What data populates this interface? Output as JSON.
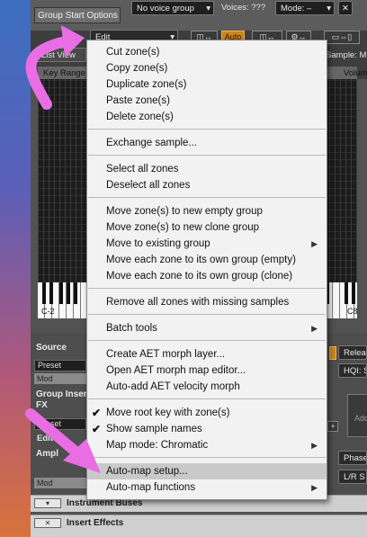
{
  "colors": {
    "accent_orange": "#c9861f",
    "menu_bg": "#f2f2f2",
    "highlight": "#c9c9c9",
    "pointer_arrow": "#e96ee3"
  },
  "header": {
    "group_start_options_tab": "Group Start Options",
    "voice_group": "No voice group",
    "voices_label": "Voices: ???",
    "mode_label": "Mode: –"
  },
  "toolbar": {
    "edit_dropdown": "Edit",
    "auto_button": "Auto",
    "list_view": "List View",
    "sample_label": "Sample: M",
    "key_range": "Key Range",
    "volume": "Volum"
  },
  "keyboard": {
    "left_note": "C-2",
    "right_note": "C8"
  },
  "left_panel": {
    "source_label": "Source",
    "preset_label": "Preset",
    "mod_label": "Mod",
    "group_insert_fx": "Group Insert FX",
    "edit_label": "Edit",
    "amp_label": "Ampl"
  },
  "right_panel": {
    "release": "Relea",
    "hqi": "HQI: S",
    "phase": "Phase",
    "lr": "L/R S",
    "add": "Add"
  },
  "bottom": {
    "instrument_buses": "Instrument Buses",
    "insert_effects": "Insert Effects"
  },
  "menu": {
    "items": [
      {
        "label": "Cut zone(s)"
      },
      {
        "label": "Copy zone(s)"
      },
      {
        "label": "Duplicate zone(s)"
      },
      {
        "label": "Paste zone(s)"
      },
      {
        "label": "Delete zone(s)"
      },
      {
        "label": "Exchange sample..."
      },
      {
        "label": "Select all zones"
      },
      {
        "label": "Deselect all zones"
      },
      {
        "label": "Move zone(s) to new empty group"
      },
      {
        "label": "Move zone(s) to new clone group"
      },
      {
        "label": "Move to existing group",
        "submenu": true
      },
      {
        "label": "Move each zone to its own group (empty)"
      },
      {
        "label": "Move each zone to its own group (clone)"
      },
      {
        "label": "Remove all zones with missing samples"
      },
      {
        "label": "Batch tools",
        "submenu": true
      },
      {
        "label": "Create AET morph layer..."
      },
      {
        "label": "Open AET morph map editor..."
      },
      {
        "label": "Auto-add AET velocity morph"
      },
      {
        "label": "Move root key with zone(s)",
        "checked": true
      },
      {
        "label": "Show sample names",
        "checked": true
      },
      {
        "label": "Map mode: Chromatic",
        "submenu": true
      },
      {
        "label": "Auto-map setup...",
        "highlighted": true
      },
      {
        "label": "Auto-map functions",
        "submenu": true
      }
    ],
    "checkmark_glyph": "✔",
    "submenu_glyph": "▶"
  }
}
